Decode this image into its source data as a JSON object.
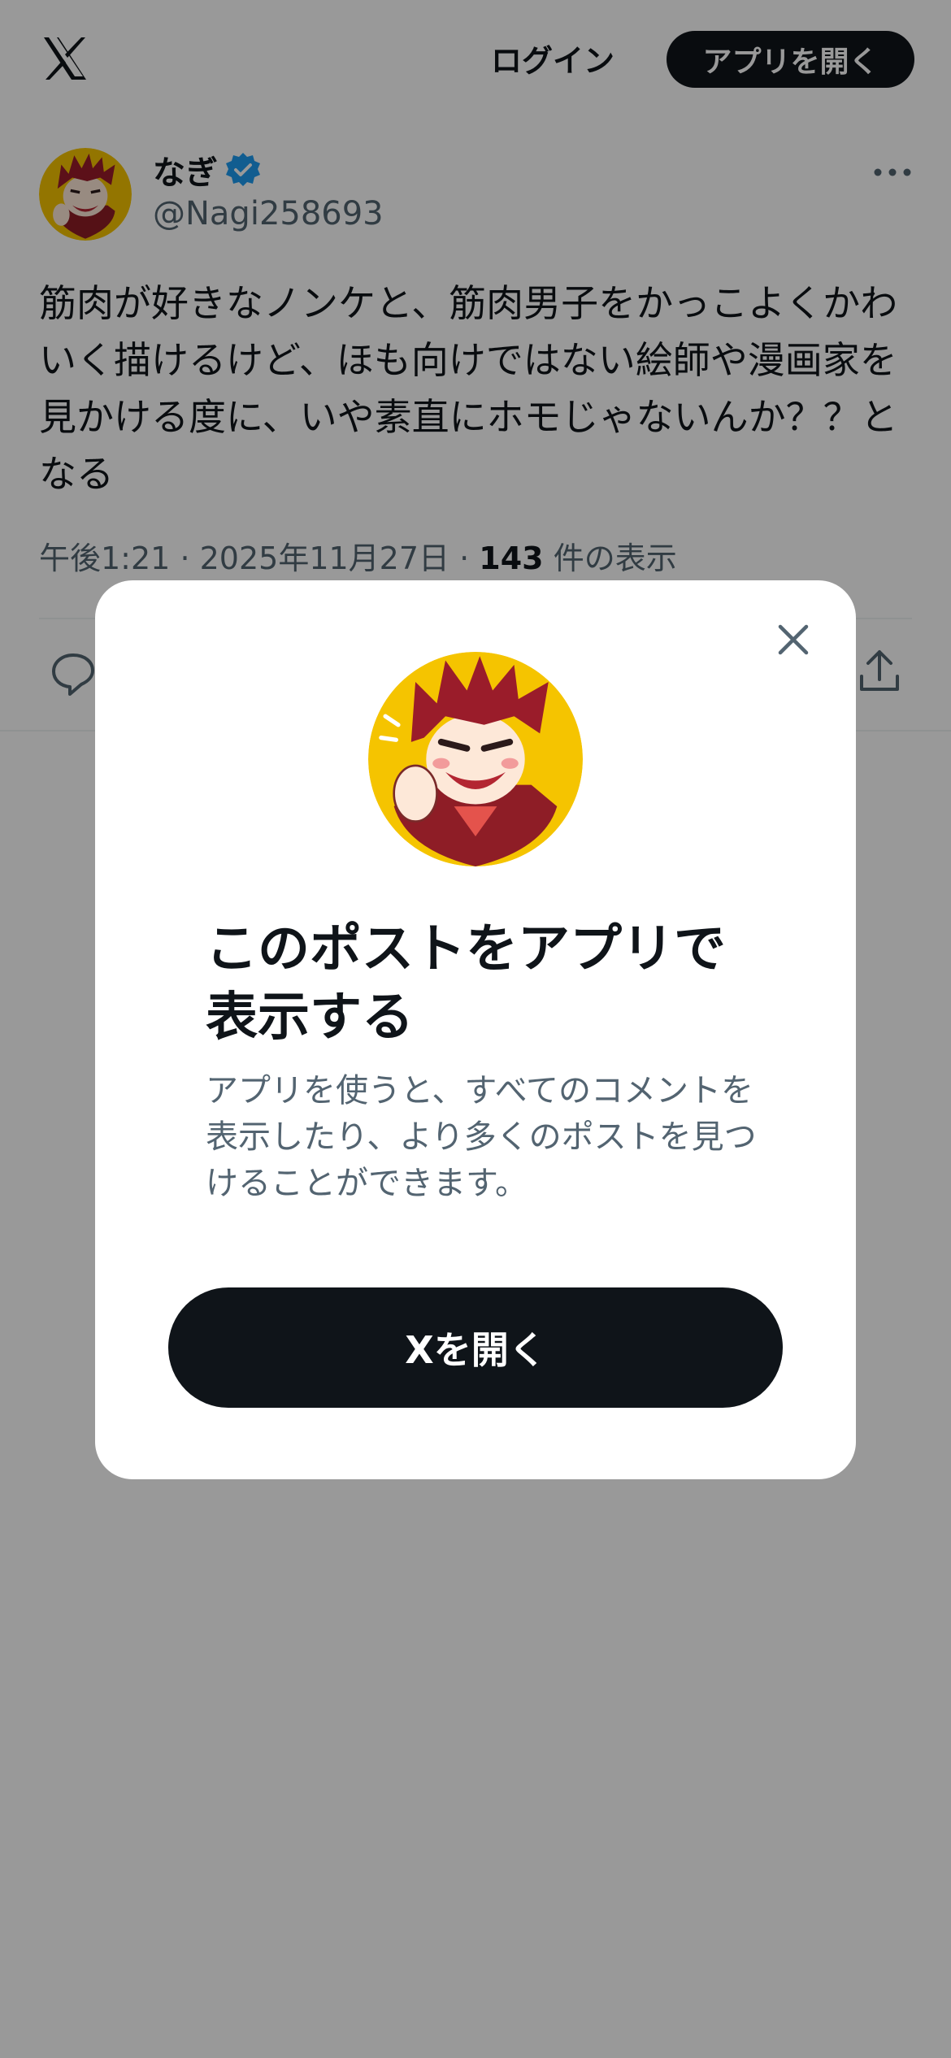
{
  "header": {
    "logo_icon": "x-logo-icon",
    "login_label": "ログイン",
    "open_app_label": "アプリを開く"
  },
  "post": {
    "author_name": "なぎ",
    "author_handle": "@Nagi258693",
    "verified_icon": "verified-badge-icon",
    "more_icon": "more-dots-icon",
    "text": "筋肉が好きなノンケと、筋肉男子をかっこよくかわいく描けるけど、ほも向けではない絵師や漫画家を見かける度に、いや素直にホモじゃないんか？？となる",
    "time": "午後1:21",
    "date": "2025年11月27日",
    "view_count": "143",
    "view_label": "件の表示",
    "reply_icon": "reply-icon",
    "share_icon": "share-icon"
  },
  "modal": {
    "close_icon": "close-icon",
    "title": "このポストをアプリで表示する",
    "description": "アプリを使うと、すべてのコメントを表示したり、より多くのポストを見つけることができます。",
    "open_button_label": "Xを開く"
  },
  "colors": {
    "text_primary": "#0f1419",
    "text_secondary": "#536471",
    "verified_blue": "#1d9bf0",
    "button_dark": "#0f1419",
    "avatar_yellow": "#f5c400",
    "hair_red": "#9a1c2a"
  }
}
